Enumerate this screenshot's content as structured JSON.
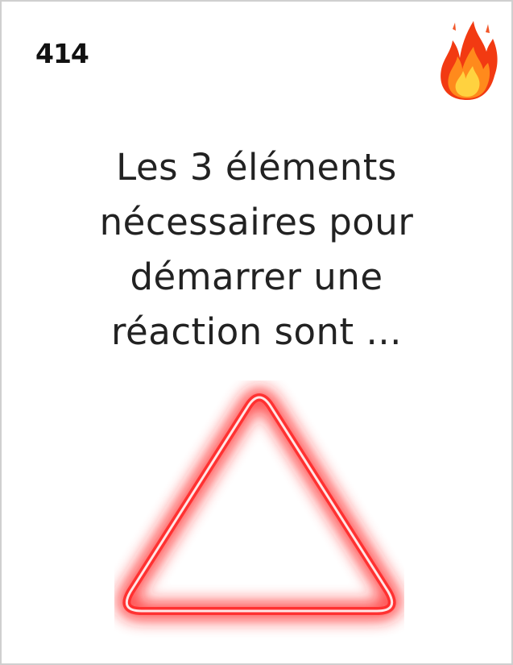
{
  "card": {
    "number": "414",
    "question": "Les 3 éléments\nnécessaires pour\ndémarrer une\nréaction sont ..."
  },
  "icons": {
    "corner": "fire-icon",
    "illustration": "fire-triangle-icon"
  },
  "colors": {
    "triangle_glow": "#ff1a1a",
    "flame_outer": "#f23a12",
    "flame_mid": "#ff8a1c",
    "flame_inner": "#ffd23f"
  }
}
